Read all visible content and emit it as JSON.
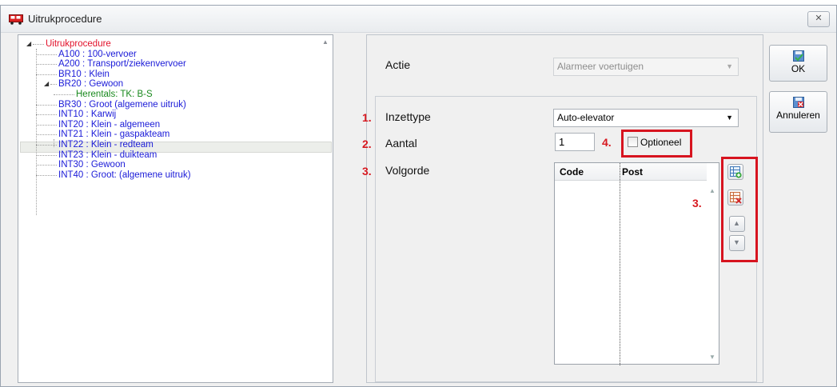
{
  "window": {
    "title": "Uitrukprocedure",
    "close_glyph": "✕"
  },
  "tree": {
    "root": "Uitrukprocedure",
    "items": [
      "A100 : 100-vervoer",
      "A200 : Transport/ziekenvervoer",
      "BR10 : Klein",
      "BR20 : Gewoon",
      "Herentals: TK: B-S",
      "BR30 : Groot (algemene uitruk)",
      "INT10 : Karwij",
      "INT20 : Klein - algemeen",
      "INT21 : Klein - gaspakteam",
      "INT22 : Klein - redteam",
      "INT23 : Klein - duikteam",
      "INT30 : Gewoon",
      "INT40 : Groot: (algemene uitruk)"
    ]
  },
  "form": {
    "actie_label": "Actie",
    "actie_value": "Alarmeer voertuigen",
    "inzettype_label": "Inzettype",
    "inzettype_value": "Auto-elevator",
    "aantal_label": "Aantal",
    "aantal_value": "1",
    "optioneel_label": "Optioneel",
    "volgorde_label": "Volgorde",
    "grid_columns": [
      "Code",
      "Post"
    ]
  },
  "annotations": {
    "n1": "1.",
    "n2": "2.",
    "n3": "3.",
    "n4": "4.",
    "n3b": "3."
  },
  "buttons": {
    "ok": "OK",
    "cancel": "Annuleren"
  },
  "colors": {
    "annotation_red": "#d7141f",
    "root_red": "#e2102a",
    "item_blue": "#1a1ad8",
    "selected_green": "#19891d"
  },
  "icons": [
    "truck-icon",
    "close-icon",
    "save-check-icon",
    "cancel-icon",
    "add-row-icon",
    "delete-row-icon",
    "move-up-icon",
    "move-down-icon"
  ]
}
